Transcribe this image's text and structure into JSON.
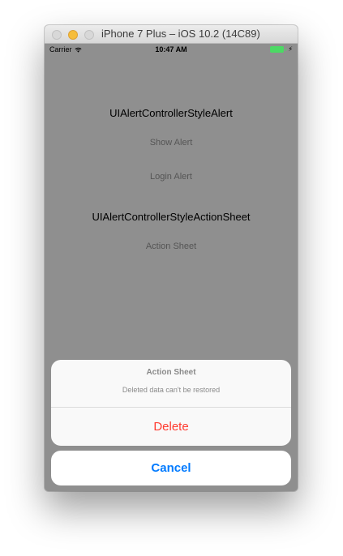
{
  "window": {
    "title": "iPhone 7 Plus – iOS 10.2 (14C89)"
  },
  "statusbar": {
    "carrier": "Carrier",
    "time": "10:47 AM",
    "wifi_icon": "wifi-icon",
    "battery_icon": "battery-charging-icon"
  },
  "content": {
    "alert_section_title": "UIAlertControllerStyleAlert",
    "show_alert_label": "Show Alert",
    "login_alert_label": "Login Alert",
    "action_sheet_section_title": "UIAlertControllerStyleActionSheet",
    "action_sheet_label": "Action Sheet"
  },
  "action_sheet": {
    "title": "Action Sheet",
    "message": "Deleted data can't be restored",
    "delete_label": "Delete",
    "cancel_label": "Cancel"
  },
  "colors": {
    "destructive": "#ff3b30",
    "ios_blue": "#007aff",
    "battery_green": "#4cd964",
    "dim_overlay": "#8f8f8f"
  }
}
